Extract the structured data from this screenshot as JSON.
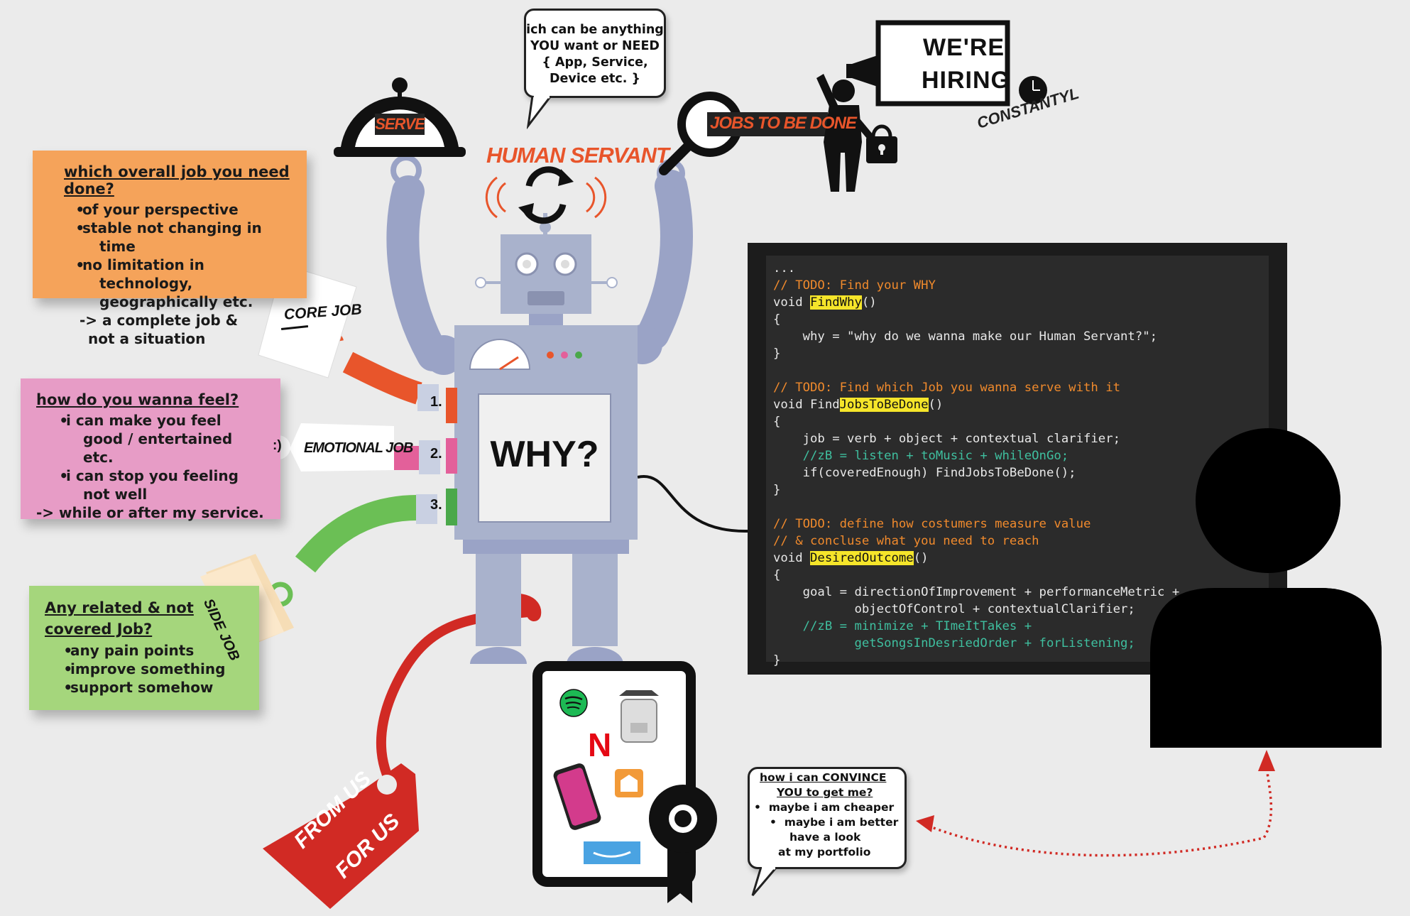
{
  "notes": {
    "orange": {
      "title": "which overall job you need done?",
      "items": [
        "of your perspective",
        "stable not changing in time",
        "no limitation in technology, geographically etc."
      ],
      "footer": [
        "-> a complete job &",
        "not a situation"
      ]
    },
    "pink": {
      "title": "how do you wanna feel?",
      "items": [
        "i can make you feel good / entertained etc.",
        "i can stop you feeling not well"
      ],
      "footer": [
        "-> while or after my service."
      ]
    },
    "green": {
      "title_lines": [
        "Any related & not ",
        "covered Job?"
      ],
      "items": [
        "any pain points",
        "improve something",
        "support somehow"
      ]
    }
  },
  "bubbles": {
    "top": [
      "ich can be anything",
      "YOU want or NEED",
      "{ App, Service,",
      "Device etc. }"
    ],
    "convince": {
      "title_lines": [
        "how i can CONVINCE",
        "YOU to get me?"
      ],
      "items": [
        "maybe i am cheaper",
        "maybe i am better"
      ],
      "extra": [
        "have a look",
        "at my portfolio"
      ]
    }
  },
  "labels": {
    "serve": "SERVE",
    "human_servant": "HUMAN SERVANT",
    "jobs_to_be_done": "JOBS TO BE DONE",
    "hiring_1": "WE'RE",
    "hiring_2": "HIRING",
    "constantyl": "CONSTANTYL",
    "core_job": "CORE JOB",
    "emotional_job": "EMOTIONAL JOB",
    "side_job": "SIDE JOB",
    "why": "WHY?",
    "num1": "1.",
    "num2": "2.",
    "num3": "3.",
    "smiley": ":)",
    "tag_1": "FROM US",
    "tag_2": "FOR US",
    "netflix": "N"
  },
  "code": {
    "l01": "...",
    "l02": "// TODO: Find your WHY",
    "l03a": "void ",
    "l03b": "FindWhy",
    "l03c": "()",
    "l04": "{",
    "l05": "    why = \"why do we wanna make our Human Servant?\";",
    "l06": "}",
    "l08": "// TODO: Find which Job you wanna serve with it",
    "l09a": "void Find",
    "l09b": "JobsToBeDone",
    "l09c": "()",
    "l10": "{",
    "l11": "    job = verb + object + contextual clarifier;",
    "l12": "    //zB = listen + toMusic + whileOnGo;",
    "l13": "    if(coveredEnough) FindJobsToBeDone();",
    "l14": "}",
    "l16": "// TODO: define how costumers measure value",
    "l17": "// & concluse what you need to reach",
    "l18a": "void ",
    "l18b": "DesiredOutcome",
    "l18c": "()",
    "l19": "{",
    "l20": "    goal = directionOfImprovement + performanceMetric +",
    "l21": "           objectOfControl + contextualClarifier;",
    "l22": "    //zB = minimize + TImeItTakes +",
    "l23": "           getSongsInDesriedOrder + forListening;",
    "l24": "}"
  },
  "colors": {
    "orange_note": "#f5a35a",
    "pink_note": "#e79cc6",
    "green_note": "#a5d67c",
    "robot": "#a9b2cc",
    "accent_red": "#e8552b",
    "tag_red": "#d12a24"
  }
}
